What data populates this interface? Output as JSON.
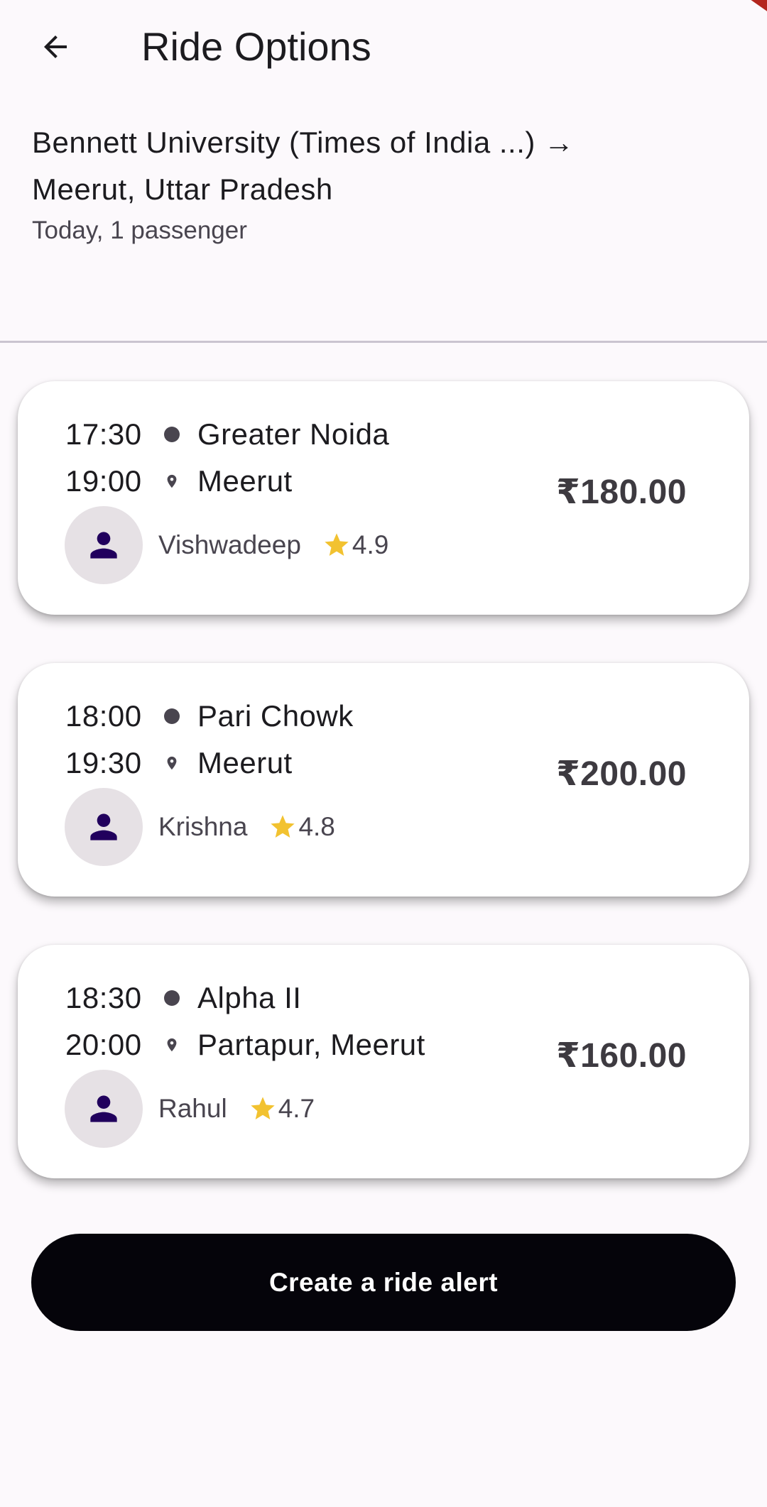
{
  "app_bar": {
    "title": "Ride Options",
    "back_icon": "arrow-left-icon"
  },
  "route": {
    "line1": "Bennett University (Times of India ...) →",
    "line2": "Meerut, Uttar Pradesh",
    "meta": "Today, 1 passenger"
  },
  "rides": [
    {
      "departure_time": "17:30",
      "departure_place": "Greater Noida",
      "arrival_time": "19:00",
      "arrival_place": "Meerut",
      "driver": "Vishwadeep",
      "rating": "4.9",
      "price": "₹180.00"
    },
    {
      "departure_time": "18:00",
      "departure_place": "Pari Chowk",
      "arrival_time": "19:30",
      "arrival_place": "Meerut",
      "driver": "Krishna",
      "rating": "4.8",
      "price": "₹200.00"
    },
    {
      "departure_time": "18:30",
      "departure_place": "Alpha II",
      "arrival_time": "20:00",
      "arrival_place": "Partapur, Meerut",
      "driver": "Rahul",
      "rating": "4.7",
      "price": "₹160.00"
    }
  ],
  "alert_button": {
    "label": "Create a ride alert"
  },
  "colors": {
    "background": "#fcf9fc",
    "avatar_icon": "#21005d",
    "star": "#f2c230",
    "button": "#05040a"
  }
}
